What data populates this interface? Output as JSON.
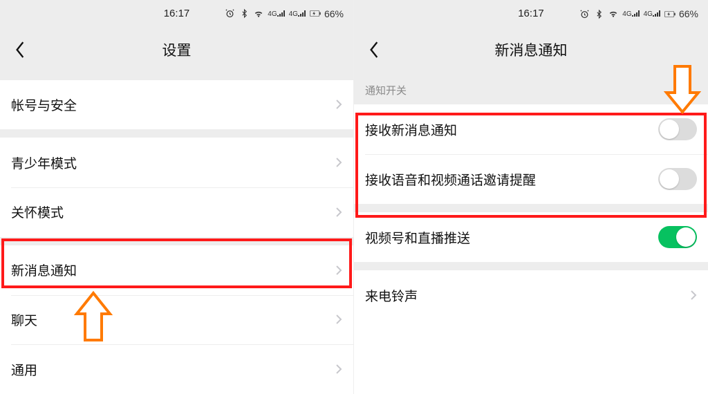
{
  "status": {
    "time": "16:17",
    "battery_pct": "66%",
    "net1": "4G",
    "net2": "4G"
  },
  "left": {
    "title": "设置",
    "rows": {
      "account_security": "帐号与安全",
      "youth_mode": "青少年模式",
      "care_mode": "关怀模式",
      "new_msg_notify": "新消息通知",
      "chat": "聊天",
      "general": "通用"
    }
  },
  "right": {
    "title": "新消息通知",
    "section_header": "通知开关",
    "rows": {
      "receive_new_msg": {
        "label": "接收新消息通知",
        "on": false
      },
      "receive_voice_video": {
        "label": "接收语音和视频通话邀请提醒",
        "on": false
      },
      "channels_live_push": {
        "label": "视频号和直播推送",
        "on": true
      },
      "ringtone": {
        "label": "来电铃声"
      }
    }
  },
  "annotations": {
    "highlight_color": "#ff1a1a",
    "arrow_color": "#ff7a00"
  }
}
